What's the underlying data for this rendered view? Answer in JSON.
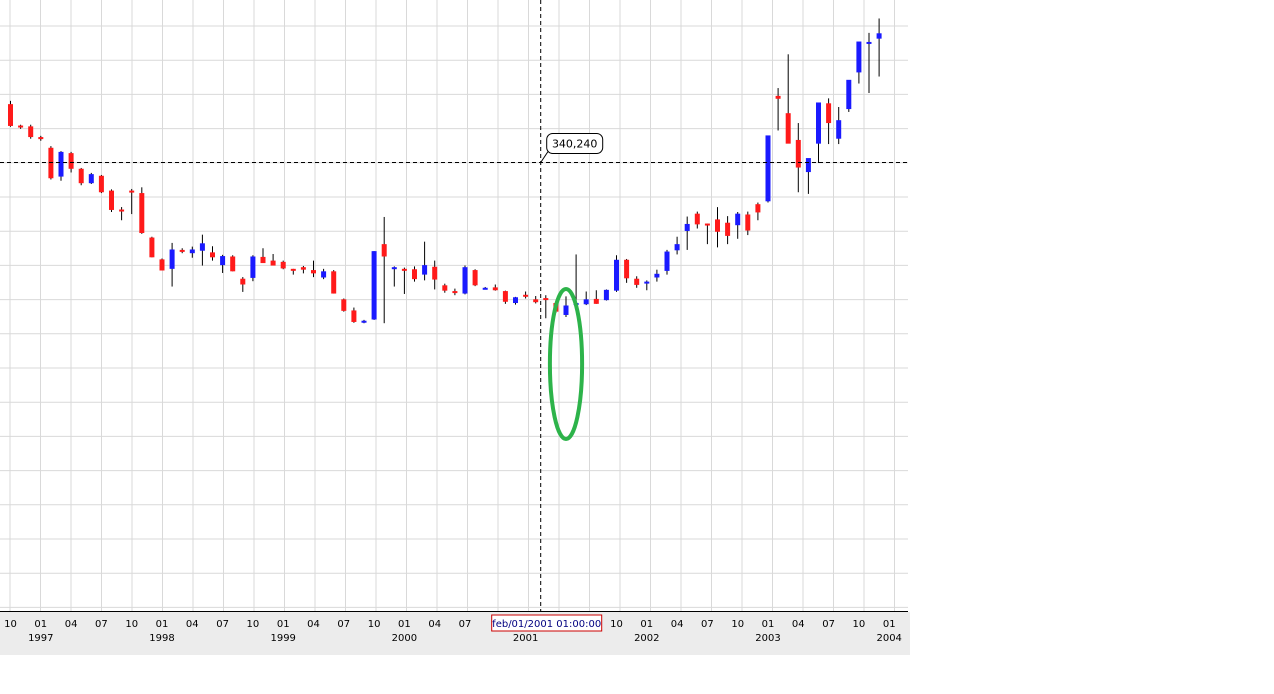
{
  "chart_data": {
    "type": "candlestick",
    "timeframe": "monthly",
    "grid": true,
    "colors": {
      "up": "#1a1aff",
      "down": "#ff1a1a",
      "wick": "#000000",
      "grid": "#d9d9d9",
      "highlight": "#2db34a",
      "date_box": "#cc0000"
    },
    "crosshair": {
      "price_label": "340,240",
      "date_label": "feb/01/2001 01:00:00",
      "price": 340.24,
      "date": "2001-02"
    },
    "highlight_ellipse": {
      "from": "2001-04",
      "to": "2001-06"
    },
    "x_ticks": [
      {
        "date": "1996-10",
        "label": "10"
      },
      {
        "date": "1997-01",
        "label": "01"
      },
      {
        "date": "1997-04",
        "label": "04"
      },
      {
        "date": "1997-07",
        "label": "07"
      },
      {
        "date": "1997-10",
        "label": "10"
      },
      {
        "date": "1998-01",
        "label": "01"
      },
      {
        "date": "1998-04",
        "label": "04"
      },
      {
        "date": "1998-07",
        "label": "07"
      },
      {
        "date": "1998-10",
        "label": "10"
      },
      {
        "date": "1999-01",
        "label": "01"
      },
      {
        "date": "1999-04",
        "label": "04"
      },
      {
        "date": "1999-07",
        "label": "07"
      },
      {
        "date": "1999-10",
        "label": "10"
      },
      {
        "date": "2000-01",
        "label": "01"
      },
      {
        "date": "2000-04",
        "label": "04"
      },
      {
        "date": "2000-07",
        "label": "07"
      },
      {
        "date": "2001-10",
        "label": "10"
      },
      {
        "date": "2002-01",
        "label": "01"
      },
      {
        "date": "2002-04",
        "label": "04"
      },
      {
        "date": "2002-07",
        "label": "07"
      },
      {
        "date": "2002-10",
        "label": "10"
      },
      {
        "date": "2003-01",
        "label": "01"
      },
      {
        "date": "2003-04",
        "label": "04"
      },
      {
        "date": "2003-07",
        "label": "07"
      },
      {
        "date": "2003-10",
        "label": "10"
      },
      {
        "date": "2004-01",
        "label": "01"
      }
    ],
    "year_labels": [
      {
        "date": "1997-01",
        "label": "1997"
      },
      {
        "date": "1998-01",
        "label": "1998"
      },
      {
        "date": "1999-01",
        "label": "1999"
      },
      {
        "date": "2000-01",
        "label": "2000"
      },
      {
        "date": "2001-01",
        "label": "2001"
      },
      {
        "date": "2002-01",
        "label": "2002"
      },
      {
        "date": "2003-01",
        "label": "2003"
      },
      {
        "date": "2004-01",
        "label": "2004"
      }
    ],
    "candles": [
      {
        "date": "1996-10",
        "o": 482,
        "h": 490,
        "l": 427,
        "c": 429
      },
      {
        "date": "1996-11",
        "o": 430,
        "h": 432,
        "l": 422,
        "c": 428
      },
      {
        "date": "1996-12",
        "o": 428,
        "h": 432,
        "l": 398,
        "c": 402
      },
      {
        "date": "1997-01",
        "o": 402,
        "h": 405,
        "l": 393,
        "c": 397
      },
      {
        "date": "1997-02",
        "o": 376,
        "h": 380,
        "l": 299,
        "c": 302
      },
      {
        "date": "1997-03",
        "o": 306,
        "h": 368,
        "l": 296,
        "c": 366
      },
      {
        "date": "1997-04",
        "o": 363,
        "h": 366,
        "l": 316,
        "c": 325
      },
      {
        "date": "1997-05",
        "o": 325,
        "h": 327,
        "l": 285,
        "c": 290
      },
      {
        "date": "1997-06",
        "o": 290,
        "h": 315,
        "l": 288,
        "c": 312
      },
      {
        "date": "1997-07",
        "o": 308,
        "h": 310,
        "l": 266,
        "c": 268
      },
      {
        "date": "1997-08",
        "o": 272,
        "h": 275,
        "l": 220,
        "c": 225
      },
      {
        "date": "1997-09",
        "o": 226,
        "h": 232,
        "l": 200,
        "c": 225
      },
      {
        "date": "1997-10",
        "o": 272,
        "h": 276,
        "l": 215,
        "c": 270
      },
      {
        "date": "1997-11",
        "o": 266,
        "h": 280,
        "l": 167,
        "c": 169
      },
      {
        "date": "1997-12",
        "o": 158,
        "h": 160,
        "l": 110,
        "c": 110
      },
      {
        "date": "1998-01",
        "o": 105,
        "h": 107,
        "l": 78,
        "c": 78
      },
      {
        "date": "1998-02",
        "o": 82,
        "h": 145,
        "l": 39,
        "c": 129
      },
      {
        "date": "1998-03",
        "o": 128,
        "h": 132,
        "l": 120,
        "c": 126
      },
      {
        "date": "1998-04",
        "o": 120,
        "h": 136,
        "l": 109,
        "c": 129
      },
      {
        "date": "1998-05",
        "o": 126,
        "h": 165,
        "l": 90,
        "c": 144
      },
      {
        "date": "1998-06",
        "o": 122,
        "h": 137,
        "l": 102,
        "c": 110
      },
      {
        "date": "1998-07",
        "o": 91,
        "h": 116,
        "l": 72,
        "c": 113
      },
      {
        "date": "1998-08",
        "o": 112,
        "h": 115,
        "l": 76,
        "c": 76
      },
      {
        "date": "1998-09",
        "o": 58,
        "h": 62,
        "l": 26,
        "c": 44
      },
      {
        "date": "1998-10",
        "o": 60,
        "h": 115,
        "l": 52,
        "c": 112
      },
      {
        "date": "1998-11",
        "o": 111,
        "h": 132,
        "l": 109,
        "c": 96
      },
      {
        "date": "1998-12",
        "o": 102,
        "h": 118,
        "l": 97,
        "c": 90
      },
      {
        "date": "1999-01",
        "o": 99,
        "h": 102,
        "l": 81,
        "c": 83
      },
      {
        "date": "1999-02",
        "o": 82,
        "h": 82,
        "l": 68,
        "c": 80
      },
      {
        "date": "1999-03",
        "o": 86,
        "h": 89,
        "l": 71,
        "c": 80
      },
      {
        "date": "1999-04",
        "o": 79,
        "h": 102,
        "l": 62,
        "c": 71
      },
      {
        "date": "1999-05",
        "o": 61,
        "h": 82,
        "l": 57,
        "c": 76
      },
      {
        "date": "1999-06",
        "o": 76,
        "h": 79,
        "l": 22,
        "c": 22
      },
      {
        "date": "1999-07",
        "o": 8,
        "h": 10,
        "l": -22,
        "c": -20
      },
      {
        "date": "1999-08",
        "o": -19,
        "h": -12,
        "l": -49,
        "c": -47
      },
      {
        "date": "1999-09",
        "o": -45,
        "h": -42,
        "l": -50,
        "c": -44
      },
      {
        "date": "1999-10",
        "o": -41,
        "h": 125,
        "l": -42,
        "c": 125
      },
      {
        "date": "1999-11",
        "o": 142,
        "h": 208,
        "l": -50,
        "c": 112
      },
      {
        "date": "1999-12",
        "o": 84,
        "h": 88,
        "l": 39,
        "c": 86
      },
      {
        "date": "2000-01",
        "o": 82,
        "h": 85,
        "l": 21,
        "c": 81
      },
      {
        "date": "2000-02",
        "o": 81,
        "h": 88,
        "l": 51,
        "c": 57
      },
      {
        "date": "2000-03",
        "o": 68,
        "h": 148,
        "l": 54,
        "c": 91
      },
      {
        "date": "2000-04",
        "o": 87,
        "h": 102,
        "l": 32,
        "c": 56
      },
      {
        "date": "2000-05",
        "o": 42,
        "h": 46,
        "l": 24,
        "c": 29
      },
      {
        "date": "2000-06",
        "o": 28,
        "h": 34,
        "l": 18,
        "c": 24
      },
      {
        "date": "2000-07",
        "o": 22,
        "h": 90,
        "l": 20,
        "c": 86
      },
      {
        "date": "2000-08",
        "o": 79,
        "h": 81,
        "l": 40,
        "c": 42
      },
      {
        "date": "2000-09",
        "o": 36,
        "h": 38,
        "l": 35,
        "c": 36
      },
      {
        "date": "2000-10",
        "o": 37,
        "h": 44,
        "l": 29,
        "c": 30
      },
      {
        "date": "2000-11",
        "o": 28,
        "h": 29,
        "l": -3,
        "c": 2
      },
      {
        "date": "2000-12",
        "o": -1,
        "h": 14,
        "l": -5,
        "c": 13
      },
      {
        "date": "2001-01",
        "o": 19,
        "h": 27,
        "l": 10,
        "c": 16
      },
      {
        "date": "2001-02",
        "o": 8,
        "h": 16,
        "l": -2,
        "c": 1
      },
      {
        "date": "2001-03",
        "o": 11,
        "h": 18,
        "l": -38,
        "c": 9
      },
      {
        "date": "2001-04",
        "o": -1,
        "h": 3,
        "l": -25,
        "c": -22
      },
      {
        "date": "2001-05",
        "o": -30,
        "h": 15,
        "l": -35,
        "c": -7
      },
      {
        "date": "2001-06",
        "o": -5,
        "h": 117,
        "l": -10,
        "c": -1
      },
      {
        "date": "2001-07",
        "o": -4,
        "h": 27,
        "l": -6,
        "c": 8
      },
      {
        "date": "2001-08",
        "o": 9,
        "h": 30,
        "l": -3,
        "c": -3
      },
      {
        "date": "2001-09",
        "o": 6,
        "h": 32,
        "l": 5,
        "c": 31
      },
      {
        "date": "2001-10",
        "o": 29,
        "h": 115,
        "l": 26,
        "c": 104
      },
      {
        "date": "2001-11",
        "o": 104,
        "h": 106,
        "l": 48,
        "c": 59
      },
      {
        "date": "2001-12",
        "o": 58,
        "h": 64,
        "l": 36,
        "c": 43
      },
      {
        "date": "2002-01",
        "o": 50,
        "h": 54,
        "l": 30,
        "c": 51
      },
      {
        "date": "2002-02",
        "o": 61,
        "h": 80,
        "l": 51,
        "c": 70
      },
      {
        "date": "2002-03",
        "o": 77,
        "h": 128,
        "l": 68,
        "c": 124
      },
      {
        "date": "2002-04",
        "o": 127,
        "h": 160,
        "l": 117,
        "c": 142
      },
      {
        "date": "2002-05",
        "o": 174,
        "h": 209,
        "l": 128,
        "c": 191
      },
      {
        "date": "2002-06",
        "o": 216,
        "h": 221,
        "l": 180,
        "c": 190
      },
      {
        "date": "2002-07",
        "o": 192,
        "h": 192,
        "l": 142,
        "c": 188
      },
      {
        "date": "2002-08",
        "o": 202,
        "h": 232,
        "l": 134,
        "c": 172
      },
      {
        "date": "2002-09",
        "o": 194,
        "h": 210,
        "l": 142,
        "c": 162
      },
      {
        "date": "2002-10",
        "o": 188,
        "h": 220,
        "l": 155,
        "c": 216
      },
      {
        "date": "2002-11",
        "o": 214,
        "h": 221,
        "l": 164,
        "c": 175
      },
      {
        "date": "2002-12",
        "o": 239,
        "h": 243,
        "l": 200,
        "c": 219
      },
      {
        "date": "2003-01",
        "o": 246,
        "h": 397,
        "l": 243,
        "c": 406
      },
      {
        "date": "2003-02",
        "o": 502,
        "h": 521,
        "l": 418,
        "c": 495
      },
      {
        "date": "2003-03",
        "o": 460,
        "h": 603,
        "l": 391,
        "c": 386
      },
      {
        "date": "2003-04",
        "o": 395,
        "h": 436,
        "l": 268,
        "c": 328
      },
      {
        "date": "2003-05",
        "o": 317,
        "h": 346,
        "l": 264,
        "c": 351
      },
      {
        "date": "2003-06",
        "o": 386,
        "h": 443,
        "l": 339,
        "c": 486
      },
      {
        "date": "2003-07",
        "o": 484,
        "h": 496,
        "l": 385,
        "c": 436
      },
      {
        "date": "2003-08",
        "o": 398,
        "h": 475,
        "l": 385,
        "c": 443
      },
      {
        "date": "2003-09",
        "o": 470,
        "h": 519,
        "l": 463,
        "c": 541
      },
      {
        "date": "2003-10",
        "o": 559,
        "h": 594,
        "l": 532,
        "c": 634
      },
      {
        "date": "2003-11",
        "o": 632,
        "h": 655,
        "l": 509,
        "c": 633
      },
      {
        "date": "2003-12",
        "o": 641,
        "h": 690,
        "l": 549,
        "c": 654
      }
    ]
  }
}
